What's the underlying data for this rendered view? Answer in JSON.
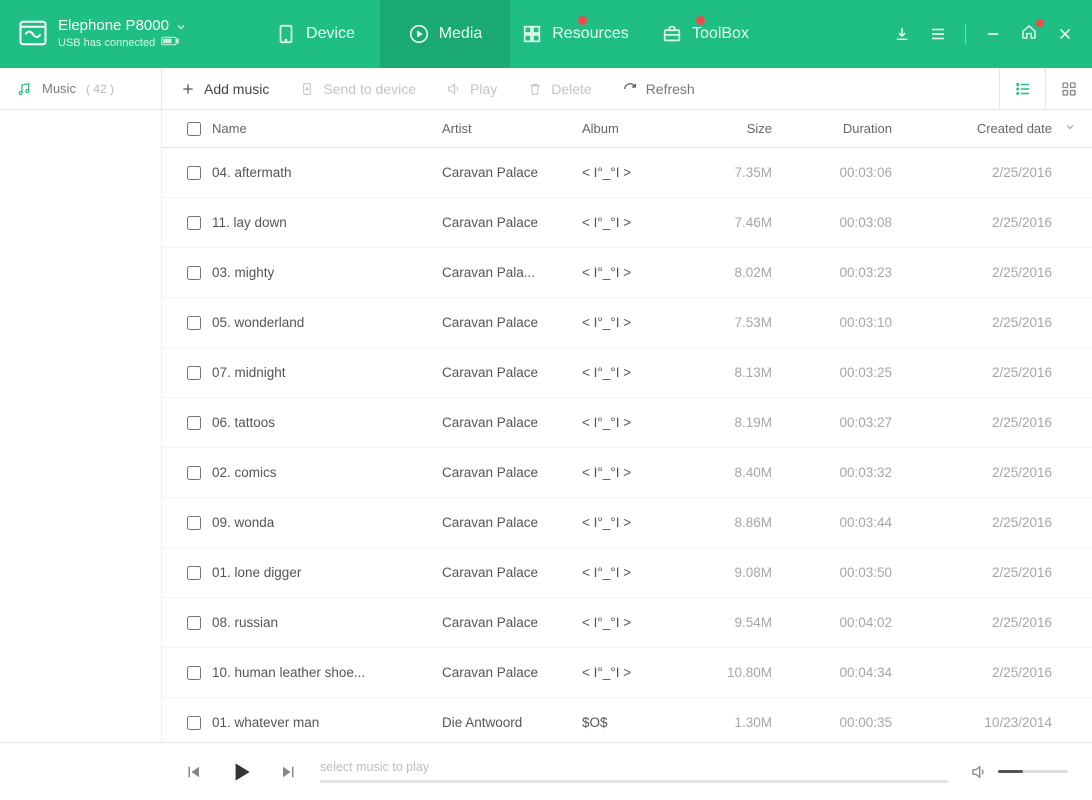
{
  "device": {
    "name": "Elephone P8000",
    "status": "USB has connected"
  },
  "nav": {
    "device": "Device",
    "media": "Media",
    "resources": "Resources",
    "toolbox": "ToolBox"
  },
  "sidebar": {
    "label": "Music",
    "count": "( 42 )"
  },
  "toolbar": {
    "add": "Add music",
    "send": "Send to device",
    "play": "Play",
    "delete": "Delete",
    "refresh": "Refresh"
  },
  "columns": {
    "name": "Name",
    "artist": "Artist",
    "album": "Album",
    "size": "Size",
    "duration": "Duration",
    "created": "Created date"
  },
  "tracks": [
    {
      "name": "04. aftermath",
      "artist": "Caravan Palace",
      "album": "< I°_°I >",
      "size": "7.35M",
      "duration": "00:03:06",
      "date": "2/25/2016"
    },
    {
      "name": "11. lay down",
      "artist": "Caravan Palace",
      "album": "< I°_°I >",
      "size": "7.46M",
      "duration": "00:03:08",
      "date": "2/25/2016"
    },
    {
      "name": "03. mighty",
      "artist": "Caravan Pala...",
      "album": "< I°_°I >",
      "size": "8.02M",
      "duration": "00:03:23",
      "date": "2/25/2016"
    },
    {
      "name": "05. wonderland",
      "artist": "Caravan Palace",
      "album": "< I°_°I >",
      "size": "7.53M",
      "duration": "00:03:10",
      "date": "2/25/2016"
    },
    {
      "name": "07. midnight",
      "artist": "Caravan Palace",
      "album": "< I°_°I >",
      "size": "8.13M",
      "duration": "00:03:25",
      "date": "2/25/2016"
    },
    {
      "name": "06. tattoos",
      "artist": "Caravan Palace",
      "album": "< I°_°I >",
      "size": "8.19M",
      "duration": "00:03:27",
      "date": "2/25/2016"
    },
    {
      "name": "02. comics",
      "artist": "Caravan Palace",
      "album": "< I°_°I >",
      "size": "8.40M",
      "duration": "00:03:32",
      "date": "2/25/2016"
    },
    {
      "name": "09. wonda",
      "artist": "Caravan Palace",
      "album": "< I°_°I >",
      "size": "8.86M",
      "duration": "00:03:44",
      "date": "2/25/2016"
    },
    {
      "name": "01. lone digger",
      "artist": "Caravan Palace",
      "album": "< I°_°I >",
      "size": "9.08M",
      "duration": "00:03:50",
      "date": "2/25/2016"
    },
    {
      "name": "08. russian",
      "artist": "Caravan Palace",
      "album": "< I°_°I >",
      "size": "9.54M",
      "duration": "00:04:02",
      "date": "2/25/2016"
    },
    {
      "name": "10. human leather shoe...",
      "artist": "Caravan Palace",
      "album": "< I°_°I >",
      "size": "10.80M",
      "duration": "00:04:34",
      "date": "2/25/2016"
    },
    {
      "name": "01. whatever man",
      "artist": "Die Antwoord",
      "album": "$O$",
      "size": "1.30M",
      "duration": "00:00:35",
      "date": "10/23/2014"
    }
  ],
  "player": {
    "placeholder": "select music to play"
  }
}
